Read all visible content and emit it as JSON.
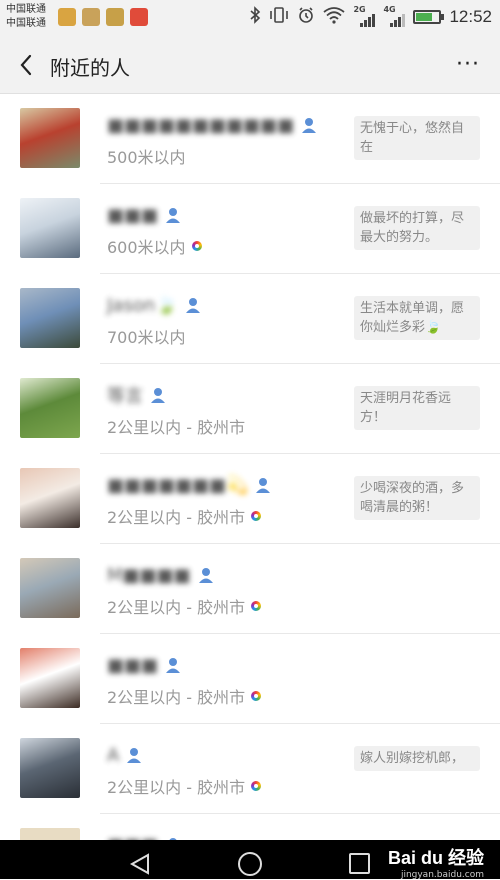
{
  "status_bar": {
    "carrier_1": "中国联通",
    "carrier_2": "中国联通",
    "network_2g": "2G",
    "network_4g": "4G",
    "time": "12:52",
    "battery_level": 0.7,
    "app_icon_colors": [
      "#d9a441",
      "#c9a25a",
      "#c7a048",
      "#e04b3a"
    ],
    "icons": [
      "bluetooth-icon",
      "vibrate-icon",
      "alarm-icon",
      "wifi-icon",
      "signal-icon",
      "battery-icon"
    ]
  },
  "header": {
    "title": "附近的人",
    "back_icon": "chevron-left-icon",
    "more_label": "···"
  },
  "people": [
    {
      "name": "■■■■■■■■■■■",
      "distance": "500米以内",
      "signature": "无愧于心，悠然自在",
      "avatar_colors": [
        "#b9412f",
        "#7a8a6a",
        "#d8c9a3"
      ],
      "has_weibo": false
    },
    {
      "name": "■■■",
      "distance": "600米以内",
      "signature": "做最坏的打算，尽最大的努力。",
      "avatar_colors": [
        "#c8d3de",
        "#5a6b7e",
        "#eef2f6"
      ],
      "has_weibo": true
    },
    {
      "name": "Jason🍃",
      "distance": "700米以内",
      "signature": "生活本就单调，愿你灿烂多彩🍃",
      "avatar_colors": [
        "#6f8fb7",
        "#3c4a3a",
        "#a9b8c9"
      ],
      "has_weibo": false
    },
    {
      "name": "等言",
      "distance": "2公里以内 - 胶州市",
      "signature": "天涯明月花香远方！",
      "avatar_colors": [
        "#5d8a3a",
        "#7da64e",
        "#e0ead0"
      ],
      "has_weibo": false
    },
    {
      "name": "■■■■■■■💫",
      "distance": "2公里以内 - 胶州市",
      "signature": "少喝深夜的酒，多喝清晨的粥！",
      "avatar_colors": [
        "#f3ebe4",
        "#3a2e2a",
        "#e8c7b5"
      ],
      "has_weibo": true
    },
    {
      "name": "M■■■■",
      "distance": "2公里以内 - 胶州市",
      "signature": "",
      "avatar_colors": [
        "#9aa9b5",
        "#7a6a5a",
        "#d4c9b8"
      ],
      "has_weibo": true
    },
    {
      "name": "■■■",
      "distance": "2公里以内 - 胶州市",
      "signature": "",
      "avatar_colors": [
        "#ffffff",
        "#3b2a22",
        "#e27f6a"
      ],
      "has_weibo": true
    },
    {
      "name": "A",
      "distance": "2公里以内 - 胶州市",
      "signature": "嫁人别嫁挖机郎，",
      "avatar_colors": [
        "#5b6673",
        "#2a2f36",
        "#cfd6de"
      ],
      "has_weibo": true
    }
  ],
  "partial_row": {
    "avatar_color": "#e8dcc3",
    "name": "■■■"
  },
  "nav": {
    "back_icon": "triangle-back-icon",
    "home_icon": "circle-home-icon",
    "recent_icon": "square-recent-icon"
  },
  "watermark": {
    "main": "Bai du 经验",
    "sub": "jingyan.baidu.com"
  },
  "colors": {
    "accent_person_icon": "#5b8fd6",
    "background": "#ffffff",
    "header_bg": "#f2f2f2"
  }
}
